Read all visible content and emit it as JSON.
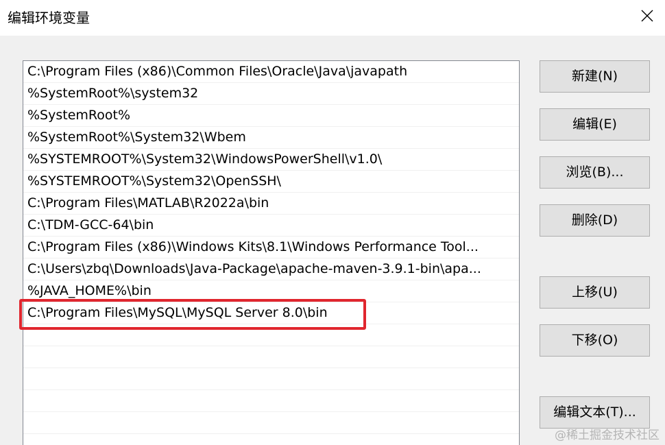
{
  "window": {
    "title": "编辑环境变量"
  },
  "paths": [
    "C:\\Program Files (x86)\\Common Files\\Oracle\\Java\\javapath",
    "%SystemRoot%\\system32",
    "%SystemRoot%",
    "%SystemRoot%\\System32\\Wbem",
    "%SYSTEMROOT%\\System32\\WindowsPowerShell\\v1.0\\",
    "%SYSTEMROOT%\\System32\\OpenSSH\\",
    "C:\\Program Files\\MATLAB\\R2022a\\bin",
    "C:\\TDM-GCC-64\\bin",
    "C:\\Program Files (x86)\\Windows Kits\\8.1\\Windows Performance Tool...",
    "C:\\Users\\zbq\\Downloads\\Java-Package\\apache-maven-3.9.1-bin\\apa...",
    "%JAVA_HOME%\\bin",
    "C:\\Program Files\\MySQL\\MySQL Server 8.0\\bin"
  ],
  "buttons": {
    "new": "新建(N)",
    "edit": "编辑(E)",
    "browse": "浏览(B)...",
    "delete": "删除(D)",
    "move_up": "上移(U)",
    "move_down": "下移(O)",
    "edit_text": "编辑文本(T)..."
  },
  "watermark": "@稀土掘金技术社区",
  "colors": {
    "highlight_border": "#e0262e"
  }
}
